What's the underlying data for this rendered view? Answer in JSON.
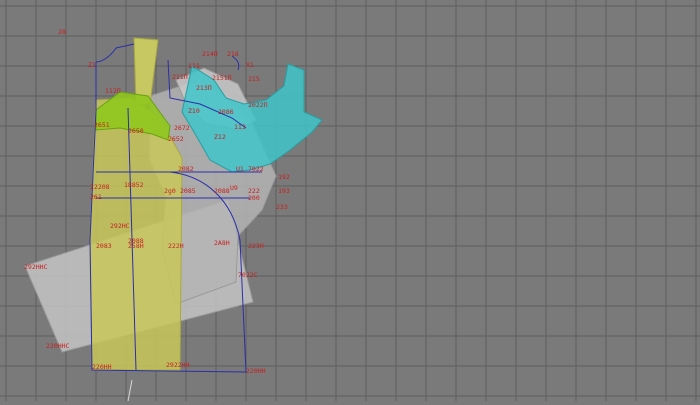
{
  "colors": {
    "background": "#7a7a7a",
    "grid": "#5f5f5f",
    "outline": "#2b2fa8",
    "label": "#c81e1e",
    "yellow_piece": "#c8c85a",
    "green_piece": "#8fc81e",
    "cyan_piece": "#3fc4c8",
    "light_piece": "#b8b8b8"
  },
  "labels": [
    {
      "id": "lbl-28",
      "text": "28"
    },
    {
      "id": "lbl-z1",
      "text": "Z1"
    },
    {
      "id": "lbl-214n",
      "text": "214П"
    },
    {
      "id": "lbl-216",
      "text": "216"
    },
    {
      "id": "lbl-x1",
      "text": "X1"
    },
    {
      "id": "lbl-211n",
      "text": "211П"
    },
    {
      "id": "lbl-2151n",
      "text": "2151П"
    },
    {
      "id": "lbl-215",
      "text": "215"
    },
    {
      "id": "lbl-111",
      "text": "111"
    },
    {
      "id": "lbl-112n",
      "text": "112П"
    },
    {
      "id": "lbl-213n",
      "text": "213П"
    },
    {
      "id": "lbl-2022n",
      "text": "2022П"
    },
    {
      "id": "lbl-z10",
      "text": "Z10"
    },
    {
      "id": "lbl-2086",
      "text": "2086"
    },
    {
      "id": "lbl-113",
      "text": "113"
    },
    {
      "id": "lbl-2651",
      "text": "2651"
    },
    {
      "id": "lbl-2650",
      "text": "2650"
    },
    {
      "id": "lbl-2672",
      "text": "2672"
    },
    {
      "id": "lbl-z12",
      "text": "Z12"
    },
    {
      "id": "lbl-2652",
      "text": "2652"
    },
    {
      "id": "lbl-u1",
      "text": "U1"
    },
    {
      "id": "lbl-7022",
      "text": "7022"
    },
    {
      "id": "lbl-192",
      "text": "192"
    },
    {
      "id": "lbl-2208",
      "text": "22208"
    },
    {
      "id": "lbl-18852",
      "text": "18852"
    },
    {
      "id": "lbl-2g0",
      "text": "2g0"
    },
    {
      "id": "lbl-u9",
      "text": "U9"
    },
    {
      "id": "lbl-222",
      "text": "222"
    },
    {
      "id": "lbl-200",
      "text": "200"
    },
    {
      "id": "lbl-193",
      "text": "193"
    },
    {
      "id": "lbl-261",
      "text": "261"
    },
    {
      "id": "lbl-2085",
      "text": "2085"
    },
    {
      "id": "lbl-2082",
      "text": "2082"
    },
    {
      "id": "lbl-2088",
      "text": "2088"
    },
    {
      "id": "lbl-233",
      "text": "233"
    },
    {
      "id": "lbl-292hc",
      "text": "292НС"
    },
    {
      "id": "lbl-2083",
      "text": "2083"
    },
    {
      "id": "lbl-2088b",
      "text": "2088"
    },
    {
      "id": "lbl-258h",
      "text": "258Н"
    },
    {
      "id": "lbl-222h",
      "text": "222Н"
    },
    {
      "id": "lbl-2a8h",
      "text": "2А8Н"
    },
    {
      "id": "lbl-223h",
      "text": "223Н"
    },
    {
      "id": "lbl-292hhc",
      "text": "292ННС"
    },
    {
      "id": "lbl-7022c",
      "text": "7022С"
    },
    {
      "id": "lbl-220hhc",
      "text": "220ННС"
    },
    {
      "id": "lbl-220hh",
      "text": "220НН"
    },
    {
      "id": "lbl-2922hh",
      "text": "2922НН"
    },
    {
      "id": "lbl-220hh-b",
      "text": "220НН"
    }
  ]
}
